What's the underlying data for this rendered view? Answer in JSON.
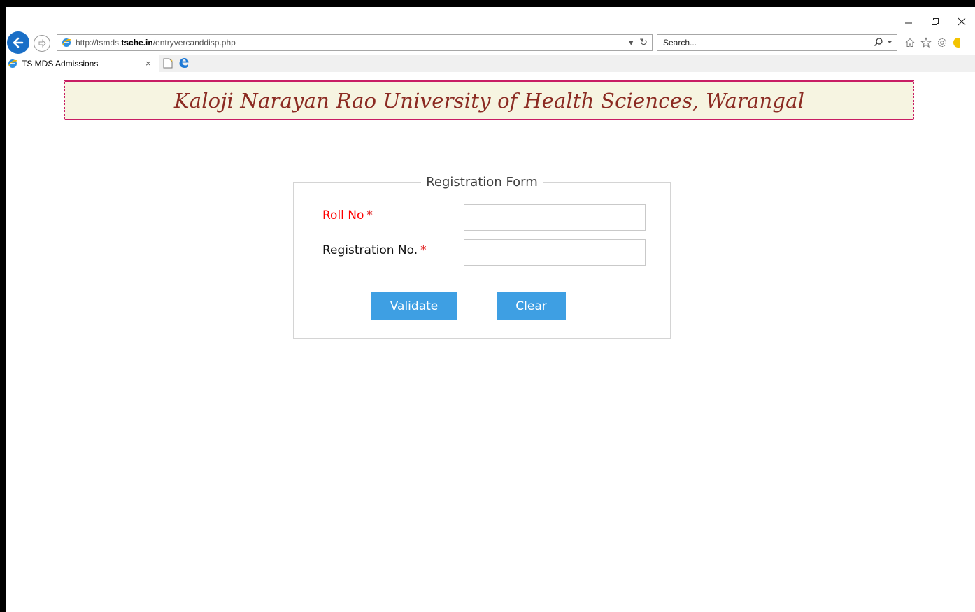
{
  "browser": {
    "url_prefix": "http://tsmds.",
    "url_domain": "tsche.in",
    "url_path": "/entryvercanddisp.php",
    "search_placeholder": "Search...",
    "tab_title": "TS MDS Admissions",
    "tab_close": "×",
    "addr_dropdown": "▾",
    "addr_refresh": "↻"
  },
  "header": {
    "banner_title": "Kaloji Narayan Rao University of Health Sciences, Warangal"
  },
  "form": {
    "legend": "Registration Form",
    "roll_label": "Roll No",
    "roll_required": "*",
    "roll_value": "",
    "reg_label": "Registration No.",
    "reg_required": "*",
    "reg_value": "",
    "validate_label": "Validate",
    "clear_label": "Clear"
  },
  "colors": {
    "banner_border": "#c81d64",
    "banner_bg": "#f6f4e1",
    "banner_text": "#8b2a22",
    "button_bg": "#3e9fe3",
    "required_label": "#ff0000"
  },
  "icons": [
    "back-arrow-icon",
    "forward-arrow-icon",
    "ie-logo-icon",
    "search-icon",
    "home-icon",
    "favorites-star-icon",
    "gear-icon",
    "smiley-icon",
    "minimize-icon",
    "restore-icon",
    "close-icon",
    "new-tab-icon",
    "edge-icon"
  ]
}
